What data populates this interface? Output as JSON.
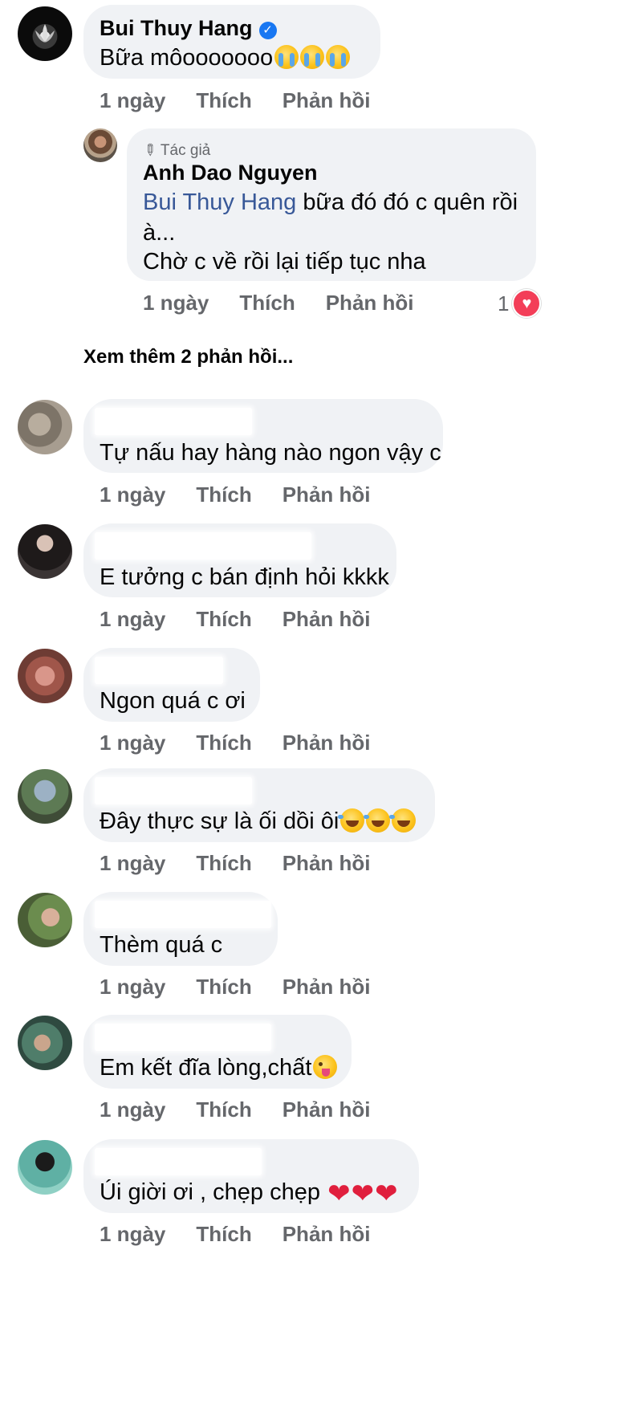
{
  "comments": [
    {
      "author": "Bui Thuy Hang",
      "verified": true,
      "text": "Bữa môooooooo",
      "time": "1 ngày",
      "like": "Thích",
      "reply": "Phản hồi"
    }
  ],
  "reply": {
    "author_tag": "Tác giả",
    "author": "Anh Dao Nguyen",
    "mention": "Bui Thuy Hang",
    "line1_rest": " bữa đó đó c quên rồi",
    "line2": "à...",
    "line3": "Chờ c về rồi lại tiếp tục nha",
    "time": "1 ngày",
    "like": "Thích",
    "reply": "Phản hồi",
    "reaction_count": "1"
  },
  "see_more": "Xem thêm 2 phản hồi...",
  "others": [
    {
      "text": "Tự nấu hay hàng nào ngon vậy c",
      "time": "1 ngày",
      "like": "Thích",
      "reply": "Phản hồi"
    },
    {
      "text": "E tưởng c bán định hỏi kkkk",
      "time": "1 ngày",
      "like": "Thích",
      "reply": "Phản hồi"
    },
    {
      "text": "Ngon quá c ơi",
      "time": "1 ngày",
      "like": "Thích",
      "reply": "Phản hồi"
    },
    {
      "text": "Đây thực sự là ối dồi ôi",
      "time": "1 ngày",
      "like": "Thích",
      "reply": "Phản hồi"
    },
    {
      "text": "Thèm quá c",
      "time": "1 ngày",
      "like": "Thích",
      "reply": "Phản hồi"
    },
    {
      "text": "Em kết đĩa lòng,chất",
      "time": "1 ngày",
      "like": "Thích",
      "reply": "Phản hồi"
    },
    {
      "text": "Úi giời ơi , chẹp chẹp ",
      "time": "1 ngày",
      "like": "Thích",
      "reply": "Phản hồi"
    }
  ],
  "icons": {
    "verified": "verified-badge-icon",
    "pencil": "pencil-icon",
    "cry": "loudly-crying-face-emoji",
    "laugh": "rolling-on-floor-laughing-emoji",
    "tongue": "winking-face-with-tongue-emoji",
    "heart": "red-heart-emoji"
  },
  "colors": {
    "bubble": "#f0f2f5",
    "meta": "#65676b",
    "mention": "#385898",
    "verified": "#1877f2",
    "love": "#f33e58"
  }
}
